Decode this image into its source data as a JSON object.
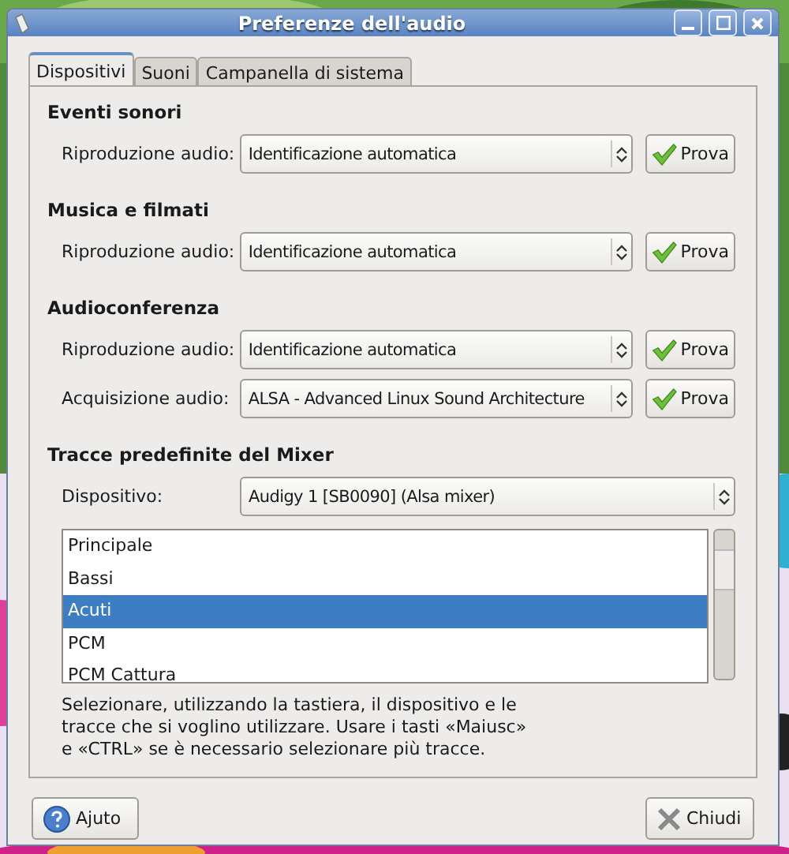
{
  "window": {
    "title": "Preferenze dell'audio"
  },
  "tabs": [
    {
      "label": "Dispositivi",
      "selected": true
    },
    {
      "label": "Suoni",
      "selected": false
    },
    {
      "label": "Campanella di sistema",
      "selected": false
    }
  ],
  "sections": [
    {
      "heading": "Eventi sonori",
      "rows": [
        {
          "label": "Riproduzione audio:",
          "value": "Identificazione automatica",
          "button": "Prova"
        }
      ]
    },
    {
      "heading": "Musica e filmati",
      "rows": [
        {
          "label": "Riproduzione audio:",
          "value": "Identificazione automatica",
          "button": "Prova"
        }
      ]
    },
    {
      "heading": "Audioconferenza",
      "rows": [
        {
          "label": "Riproduzione audio:",
          "value": "Identificazione automatica",
          "button": "Prova"
        },
        {
          "label": "Acquisizione audio:",
          "value": "ALSA - Advanced Linux Sound Architecture",
          "button": "Prova"
        }
      ]
    }
  ],
  "mixer": {
    "heading": "Tracce predefinite del Mixer",
    "device_label": "Dispositivo:",
    "device_value": "Audigy 1 [SB0090] (Alsa mixer)",
    "tracks": [
      {
        "label": "Principale",
        "selected": false
      },
      {
        "label": "Bassi",
        "selected": false
      },
      {
        "label": "Acuti",
        "selected": true
      },
      {
        "label": "PCM",
        "selected": false
      },
      {
        "label": "PCM Cattura",
        "selected": false
      }
    ],
    "hint": "Selezionare, utilizzando la tastiera, il dispositivo e le tracce che si voglino utilizzare. Usare i tasti «Maiusc» e «CTRL» se è necessario selezionare più tracce."
  },
  "buttons": {
    "help": "Ajuto",
    "close": "Chiudi"
  }
}
